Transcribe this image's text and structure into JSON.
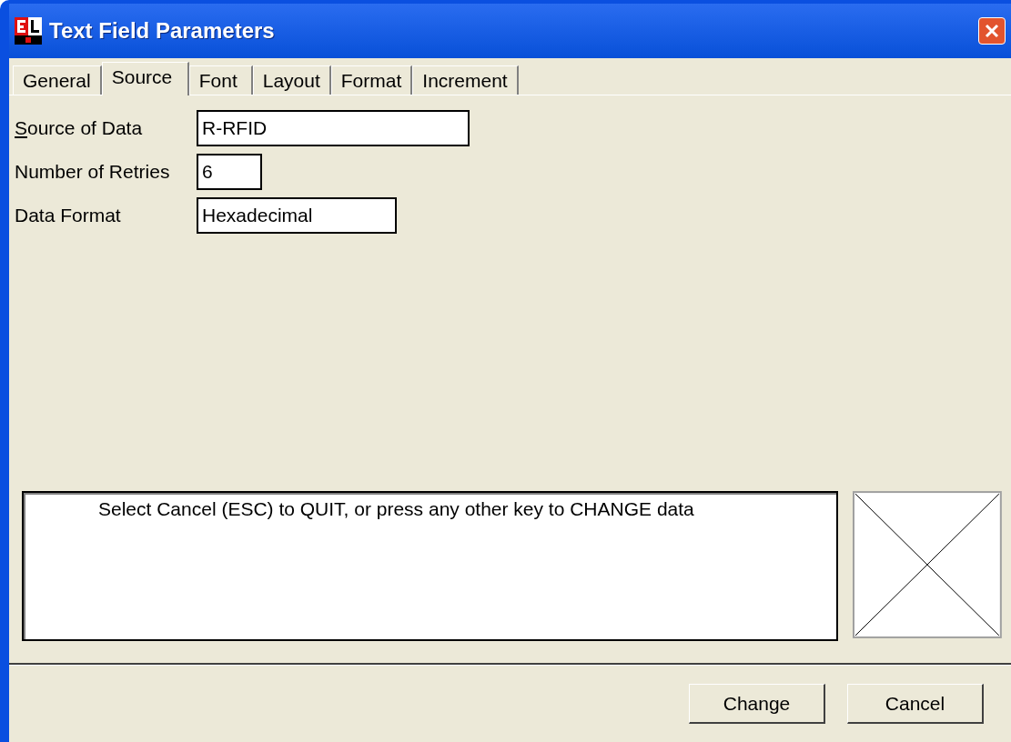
{
  "window": {
    "title": "Text Field Parameters"
  },
  "tabs": [
    {
      "label": "General",
      "selected": false
    },
    {
      "label": "Source",
      "selected": true
    },
    {
      "label": "Font",
      "selected": false
    },
    {
      "label": "Layout",
      "selected": false
    },
    {
      "label": "Format",
      "selected": false
    },
    {
      "label": "Increment",
      "selected": false
    }
  ],
  "fields": [
    {
      "label": "Source of Data",
      "mnemonic": true,
      "value": "R-RFID"
    },
    {
      "label": "Number of Retries",
      "mnemonic": false,
      "value": "6"
    },
    {
      "label": "Data Format",
      "mnemonic": false,
      "value": "Hexadecimal"
    }
  ],
  "message": "Select Cancel (ESC) to QUIT, or press any other key to CHANGE data",
  "preview": {
    "kind": "empty"
  },
  "buttons": [
    "Change",
    "Cancel"
  ]
}
